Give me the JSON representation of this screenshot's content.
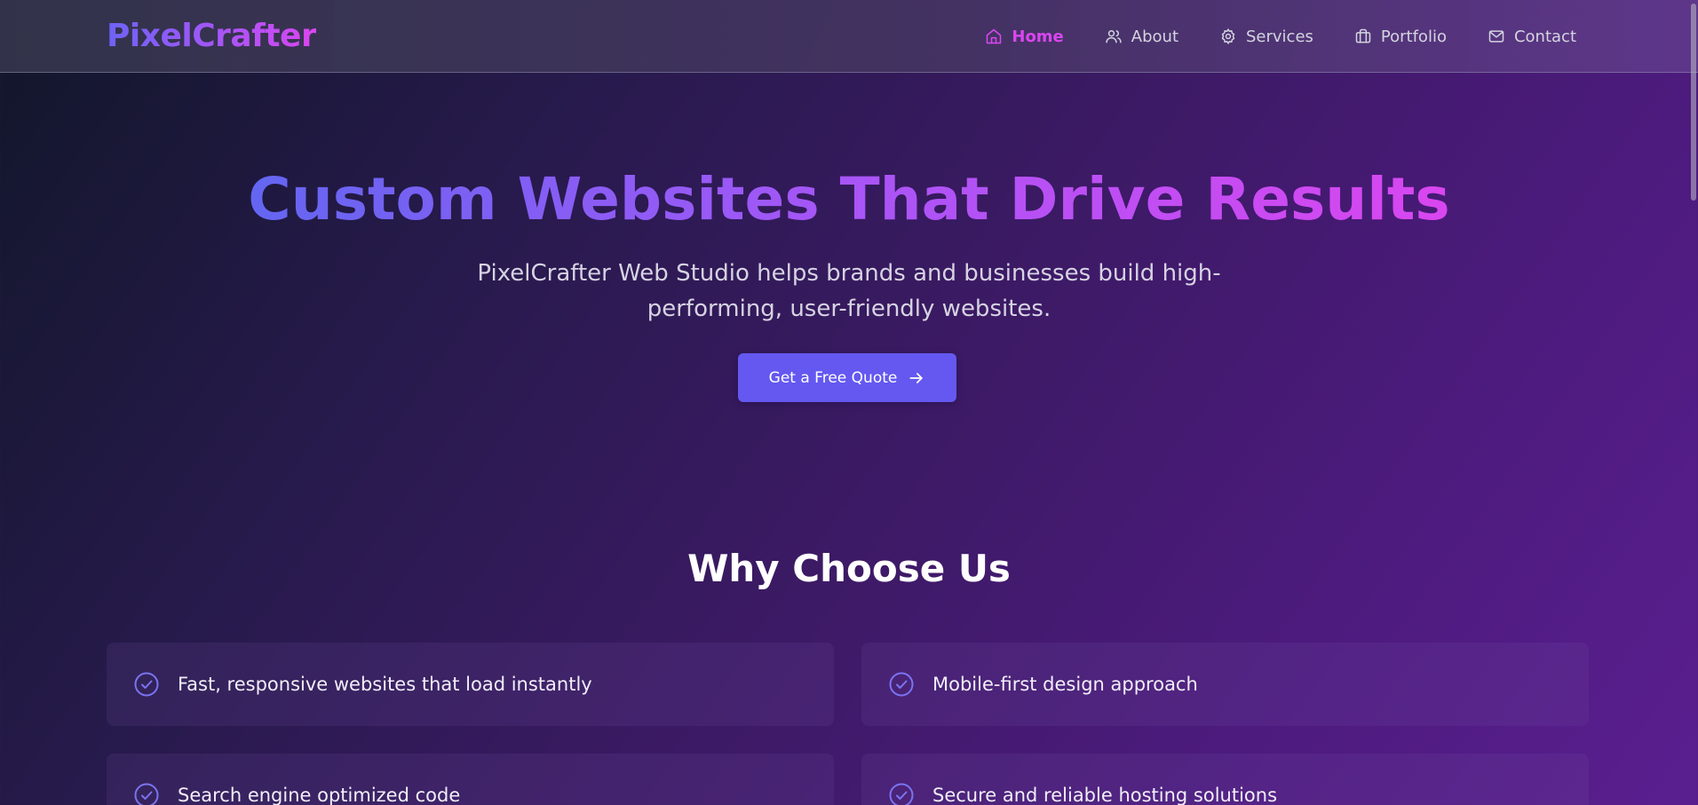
{
  "brand": {
    "logo": "PixelCrafter"
  },
  "nav": {
    "items": [
      {
        "label": "Home",
        "icon": "home-icon",
        "active": true
      },
      {
        "label": "About",
        "icon": "users-icon",
        "active": false
      },
      {
        "label": "Services",
        "icon": "gear-icon",
        "active": false
      },
      {
        "label": "Portfolio",
        "icon": "briefcase-icon",
        "active": false
      },
      {
        "label": "Contact",
        "icon": "mail-icon",
        "active": false
      }
    ]
  },
  "hero": {
    "title": "Custom Websites That Drive Results",
    "subtitle": "PixelCrafter Web Studio helps brands and businesses build high-performing, user-friendly websites.",
    "cta_label": "Get a Free Quote",
    "cta_icon": "arrow-right-icon"
  },
  "why": {
    "title": "Why Choose Us",
    "features": [
      {
        "text": "Fast, responsive websites that load instantly",
        "icon": "check-circle-icon"
      },
      {
        "text": "Mobile-first design approach",
        "icon": "check-circle-icon"
      },
      {
        "text": "Search engine optimized code",
        "icon": "check-circle-icon"
      },
      {
        "text": "Secure and reliable hosting solutions",
        "icon": "check-circle-icon"
      }
    ]
  },
  "colors": {
    "accent": "#6458f0",
    "active_nav": "#d946ef",
    "gradient_start": "#6366f1",
    "gradient_end": "#d946ef",
    "check_icon": "#7b74f2"
  }
}
